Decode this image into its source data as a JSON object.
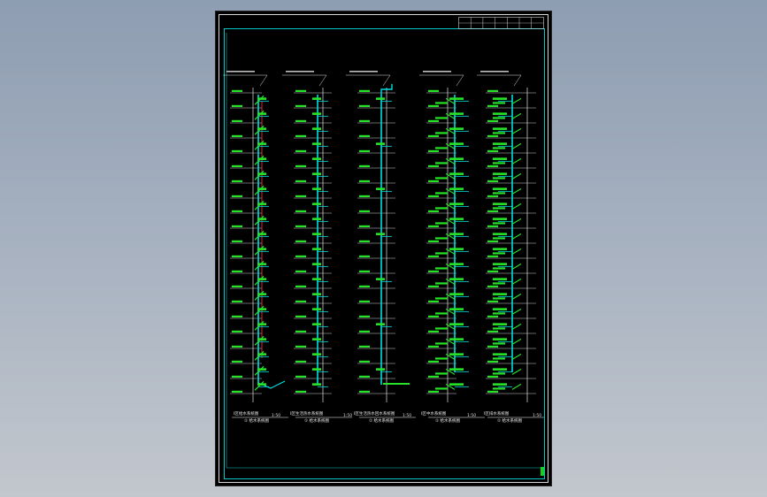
{
  "sheet": {
    "background": "#000000",
    "frame_color": "#00c8c8",
    "pipe_color": "#00e0e0",
    "tag_color": "#27e327",
    "riser_color": "#ff2a2a",
    "title_block_color": "#d0d0d0"
  },
  "diagrams": [
    {
      "id": "d1",
      "caption": "Ⅰ区给水系统图",
      "sub": "① 给水系统图",
      "scale": "1:50"
    },
    {
      "id": "d2",
      "caption": "Ⅰ区生活热水系统图",
      "sub": "① 给水系统图",
      "scale": "1:50"
    },
    {
      "id": "d3",
      "caption": "Ⅰ区生活热水回水系统图",
      "sub": "① 给水系统图",
      "scale": "1:50"
    },
    {
      "id": "d4",
      "caption": "Ⅰ区中水系统图",
      "sub": "① 给水系统图",
      "scale": "1:50"
    },
    {
      "id": "d5",
      "caption": "Ⅰ区排水系统图",
      "sub": "① 给水系统图",
      "scale": "1:50"
    }
  ],
  "floors": 20
}
